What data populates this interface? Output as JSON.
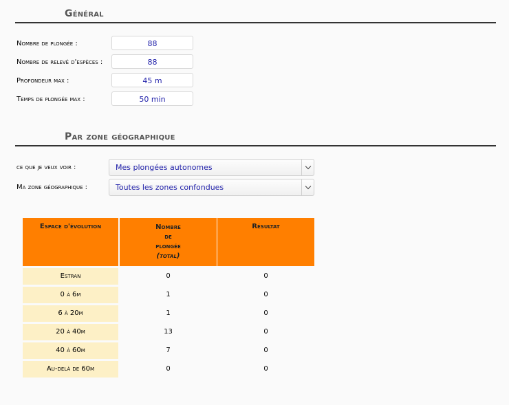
{
  "general": {
    "title": "Général",
    "rows": [
      {
        "label": "Nombre de plongée :",
        "value": "88"
      },
      {
        "label": "Nombre de relevé d'espèces :",
        "value": "88"
      },
      {
        "label": "Profondeur max :",
        "value": "45 m"
      },
      {
        "label": "Temps de plongée max :",
        "value": "50 min"
      }
    ]
  },
  "zone": {
    "title": "Par zone géographique",
    "view_label": "ce que je veux voir :",
    "view_value": "Mes plongées autonomes",
    "zone_label": "Ma zone géographique :",
    "zone_value": "Toutes les zones confondues"
  },
  "table": {
    "headers": {
      "col1": "Espace d'évolution",
      "col2_l1": "Nombre",
      "col2_l2": "de",
      "col2_l3": "plongée",
      "col2_l4": "(total)",
      "col3": "Résultat"
    },
    "rows": [
      {
        "space": "Estran",
        "count": "0",
        "result": "0"
      },
      {
        "space": "0 à 6m",
        "count": "1",
        "result": "0"
      },
      {
        "space": "6 à 20m",
        "count": "1",
        "result": "0"
      },
      {
        "space": "20 à 40m",
        "count": "13",
        "result": "0"
      },
      {
        "space": "40 à 60m",
        "count": "7",
        "result": "0"
      },
      {
        "space": "Au-delà de 60m",
        "count": "0",
        "result": "0"
      }
    ]
  },
  "colors": {
    "header_bg": "#ff7f00",
    "category_bg": "#fdf0c6",
    "value_text": "#2222aa"
  }
}
